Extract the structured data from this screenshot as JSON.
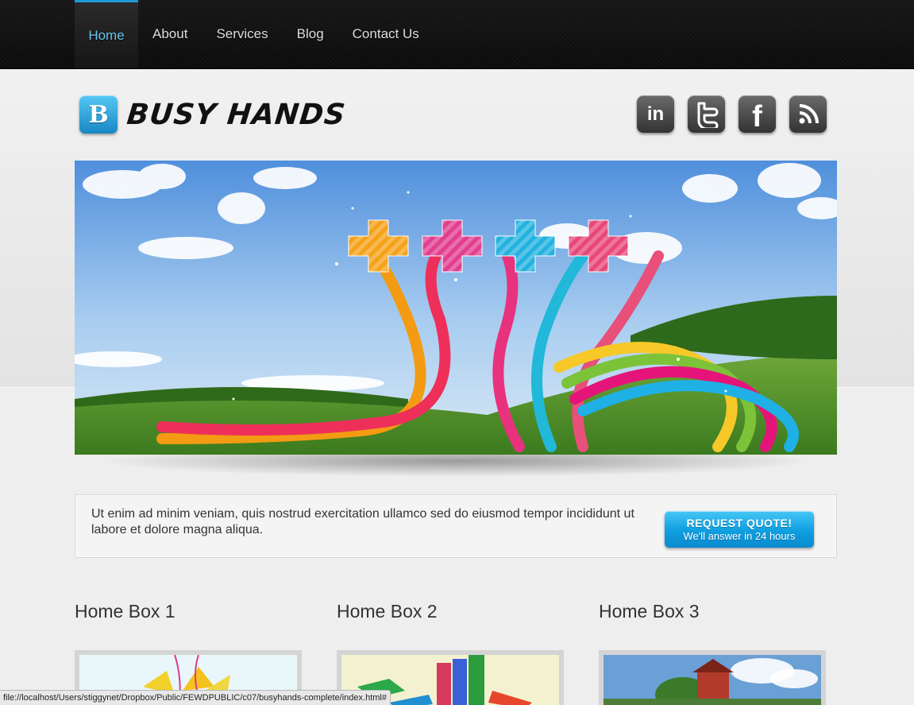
{
  "nav": {
    "items": [
      {
        "label": "Home",
        "active": true
      },
      {
        "label": "About"
      },
      {
        "label": "Services"
      },
      {
        "label": "Blog"
      },
      {
        "label": "Contact Us"
      }
    ]
  },
  "brand": {
    "badge_letter": "B",
    "name": "BUSY HANDS"
  },
  "social": [
    {
      "icon": "linkedin-icon",
      "glyph": "in"
    },
    {
      "icon": "twitter-icon"
    },
    {
      "icon": "facebook-icon",
      "glyph": "f"
    },
    {
      "icon": "rss-icon"
    }
  ],
  "cta": {
    "text": "Ut enim ad minim veniam, quis nostrud exercitation ullamco sed do eiusmod tempor incididunt ut labore et dolore magna aliqua.",
    "button_title": "REQUEST QUOTE!",
    "button_subtitle": "We'll answer in 24 hours"
  },
  "home_boxes": [
    {
      "title": "Home Box 1"
    },
    {
      "title": "Home Box 2"
    },
    {
      "title": "Home Box 3"
    }
  ],
  "status_url": "file://localhost/Users/stiggynet/Dropbox/Public/FEWDPUBLIC/c07/busyhands-complete/index.html#",
  "colors": {
    "accent": "#1f9ad6",
    "nav_active_text": "#6ec5f2",
    "cta_button": "#0e9ee0"
  }
}
